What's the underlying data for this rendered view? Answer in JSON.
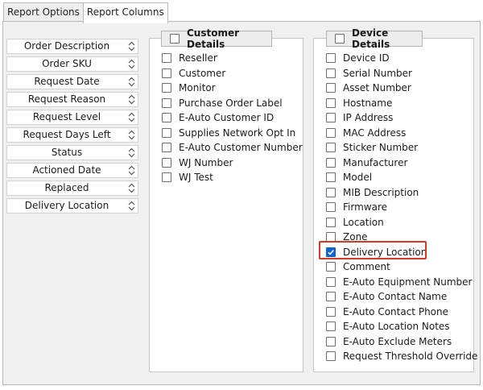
{
  "tabs": [
    {
      "label": "Report Options",
      "active": false
    },
    {
      "label": "Report Columns",
      "active": true
    }
  ],
  "columns": [
    {
      "label": "Order Description"
    },
    {
      "label": "Order SKU"
    },
    {
      "label": "Request Date"
    },
    {
      "label": "Request Reason"
    },
    {
      "label": "Request Level"
    },
    {
      "label": "Request Days Left"
    },
    {
      "label": "Status"
    },
    {
      "label": "Actioned Date"
    },
    {
      "label": "Replaced"
    },
    {
      "label": "Delivery Location"
    }
  ],
  "customer_details": {
    "title": "Customer Details",
    "checked": false,
    "items": [
      {
        "label": "Reseller",
        "checked": false
      },
      {
        "label": "Customer",
        "checked": false
      },
      {
        "label": "Monitor",
        "checked": false
      },
      {
        "label": "Purchase Order Label",
        "checked": false
      },
      {
        "label": "E-Auto Customer ID",
        "checked": false
      },
      {
        "label": "Supplies Network Opt In",
        "checked": false
      },
      {
        "label": "E-Auto Customer Number",
        "checked": false
      },
      {
        "label": "WJ Number",
        "checked": false
      },
      {
        "label": "WJ Test",
        "checked": false
      }
    ]
  },
  "device_details": {
    "title": "Device Details",
    "checked": false,
    "items": [
      {
        "label": "Device ID",
        "checked": false
      },
      {
        "label": "Serial Number",
        "checked": false
      },
      {
        "label": "Asset Number",
        "checked": false
      },
      {
        "label": "Hostname",
        "checked": false
      },
      {
        "label": "IP Address",
        "checked": false
      },
      {
        "label": "MAC Address",
        "checked": false
      },
      {
        "label": "Sticker Number",
        "checked": false
      },
      {
        "label": "Manufacturer",
        "checked": false
      },
      {
        "label": "Model",
        "checked": false
      },
      {
        "label": "MIB Description",
        "checked": false
      },
      {
        "label": "Firmware",
        "checked": false
      },
      {
        "label": "Location",
        "checked": false
      },
      {
        "label": "Zone",
        "checked": false
      },
      {
        "label": "Delivery Location",
        "checked": true
      },
      {
        "label": "Comment",
        "checked": false
      },
      {
        "label": "E-Auto Equipment Number",
        "checked": false
      },
      {
        "label": "E-Auto Contact Name",
        "checked": false
      },
      {
        "label": "E-Auto Contact Phone",
        "checked": false
      },
      {
        "label": "E-Auto Location Notes",
        "checked": false
      },
      {
        "label": "E-Auto Exclude Meters",
        "checked": false
      },
      {
        "label": "Request Threshold Override",
        "checked": false
      }
    ]
  },
  "colors": {
    "highlight": "#d33a1e",
    "checkbox_checked": "#0f62d4"
  }
}
